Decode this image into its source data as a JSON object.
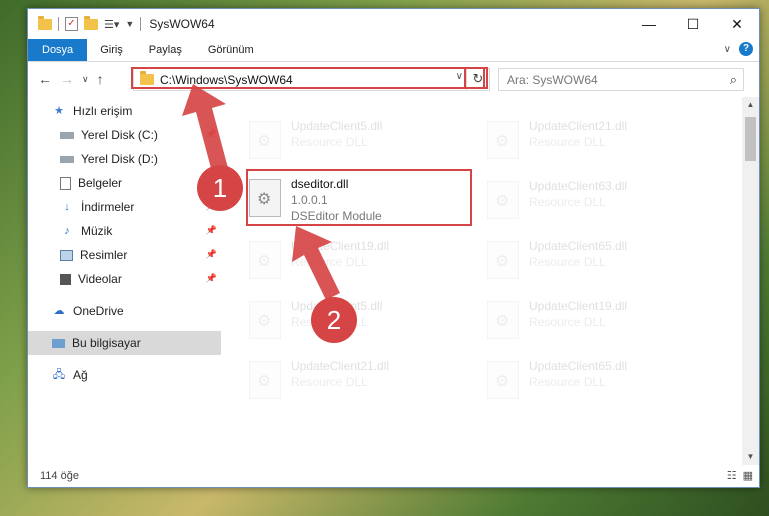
{
  "window": {
    "title": "SysWOW64",
    "controls": {
      "minimize": "—",
      "maximize": "☐",
      "close": "✕"
    }
  },
  "ribbon": {
    "tabs": [
      {
        "label": "Dosya"
      },
      {
        "label": "Giriş"
      },
      {
        "label": "Paylaş"
      },
      {
        "label": "Görünüm"
      }
    ],
    "help": "?"
  },
  "address": {
    "path": "C:\\Windows\\SysWOW64",
    "search_placeholder": "Ara: SysWOW64"
  },
  "sidebar": {
    "items": [
      {
        "label": "Hızlı erişim",
        "icon": "star-icon"
      },
      {
        "label": "Yerel Disk (C:)",
        "icon": "drive-icon"
      },
      {
        "label": "Yerel Disk (D:)",
        "icon": "drive-icon"
      },
      {
        "label": "Belgeler",
        "icon": "documents-icon"
      },
      {
        "label": "İndirmeler",
        "icon": "download-icon"
      },
      {
        "label": "Müzik",
        "icon": "music-icon"
      },
      {
        "label": "Resimler",
        "icon": "pictures-icon"
      },
      {
        "label": "Videolar",
        "icon": "video-icon"
      },
      {
        "label": "OneDrive",
        "icon": "cloud-icon"
      },
      {
        "label": "Bu bilgisayar",
        "icon": "computer-icon"
      },
      {
        "label": "Ağ",
        "icon": "network-icon"
      }
    ]
  },
  "files": {
    "faded": [
      {
        "name": "UpdateClient5.dll",
        "type": "Resource DLL"
      },
      {
        "name": "UpdateClient21.dll",
        "type": "Resource DLL"
      },
      {
        "name": "UpdateClient63.dll",
        "type": "Resource DLL"
      },
      {
        "name": "UpdateClient19.dll",
        "type": "Resource DLL"
      },
      {
        "name": "UpdateClient65.dll",
        "type": "Resource DLL"
      },
      {
        "name": "UpdateClient5.dll",
        "type": "Resource DLL"
      },
      {
        "name": "UpdateClient19.dll",
        "type": "Resource DLL"
      },
      {
        "name": "UpdateClient21.dll",
        "type": "Resource DLL"
      },
      {
        "name": "UpdateClient65.dll",
        "type": "Resource DLL"
      }
    ],
    "selected": {
      "name": "dseditor.dll",
      "version": "1.0.0.1",
      "description": "DSEditor Module"
    }
  },
  "status": {
    "count": "114 öğe"
  },
  "annotations": {
    "step1": "1",
    "step2": "2",
    "color": "#d64545"
  }
}
